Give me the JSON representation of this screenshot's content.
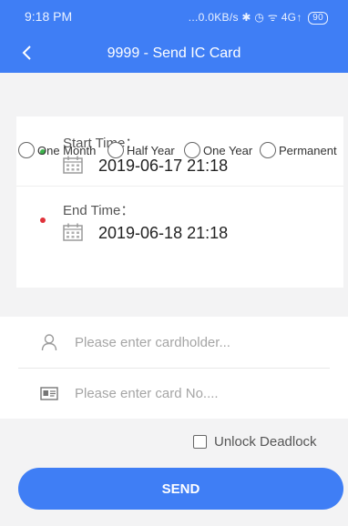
{
  "status_bar": {
    "time": "9:18 PM",
    "indicators": "...0.0KB/s ✱ ◷ ᯤ 4G↑",
    "battery": "90"
  },
  "nav": {
    "title": "9999 - Send IC Card",
    "back_icon": "chevron-left-icon"
  },
  "validity": {
    "start_label": "Start Time：",
    "start_value": "2019-06-17 21:18",
    "end_label": "End Time：",
    "end_value": "2019-06-18 21:18",
    "start_dot_color": "#3cb44b",
    "end_dot_color": "#e0323a",
    "calendar_icon": "calendar-icon",
    "periods": [
      {
        "label": "One Month",
        "selected": false
      },
      {
        "label": "Half Year",
        "selected": false
      },
      {
        "label": "One Year",
        "selected": false
      },
      {
        "label": "Permanent",
        "selected": false
      }
    ]
  },
  "form": {
    "cardholder_placeholder": "Please enter cardholder...",
    "cardholder_value": "",
    "cardholder_icon": "user-icon",
    "card_no_placeholder": "Please enter card No....",
    "card_no_value": "",
    "card_no_icon": "id-card-icon"
  },
  "options": {
    "unlock_deadlock_label": "Unlock Deadlock",
    "unlock_deadlock_checked": false
  },
  "actions": {
    "send_label": "SEND"
  },
  "colors": {
    "accent": "#3f7ef5",
    "background": "#f3f3f4"
  }
}
